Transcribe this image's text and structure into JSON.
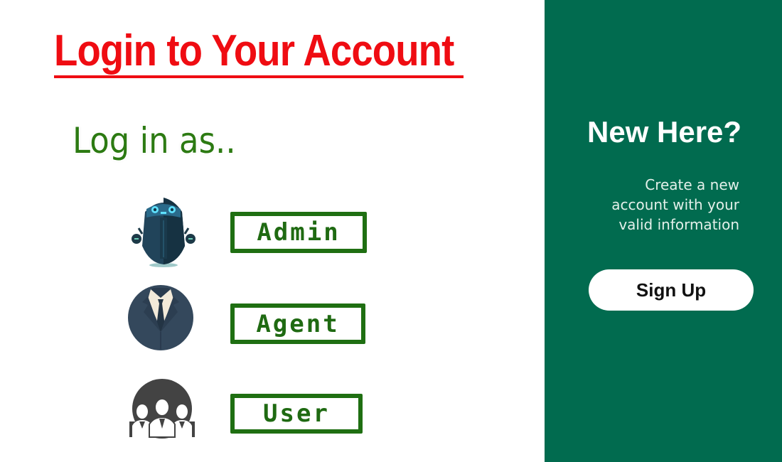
{
  "login_panel": {
    "title": "Login to Your Account",
    "subtitle": "Log in as..",
    "roles": [
      {
        "label": "Admin",
        "icon": "robot-admin-icon"
      },
      {
        "label": "Agent",
        "icon": "suit-agent-icon"
      },
      {
        "label": "User",
        "icon": "user-group-icon"
      }
    ]
  },
  "signup_panel": {
    "heading": "New Here?",
    "description_lines": [
      "Create a new",
      "account with your",
      "valid information"
    ],
    "signup_label": "Sign Up"
  },
  "colors": {
    "title_red": "#ef0c12",
    "green_text": "#2c7a12",
    "panel_green": "#016b4f",
    "button_border_green": "#1f6f12"
  }
}
